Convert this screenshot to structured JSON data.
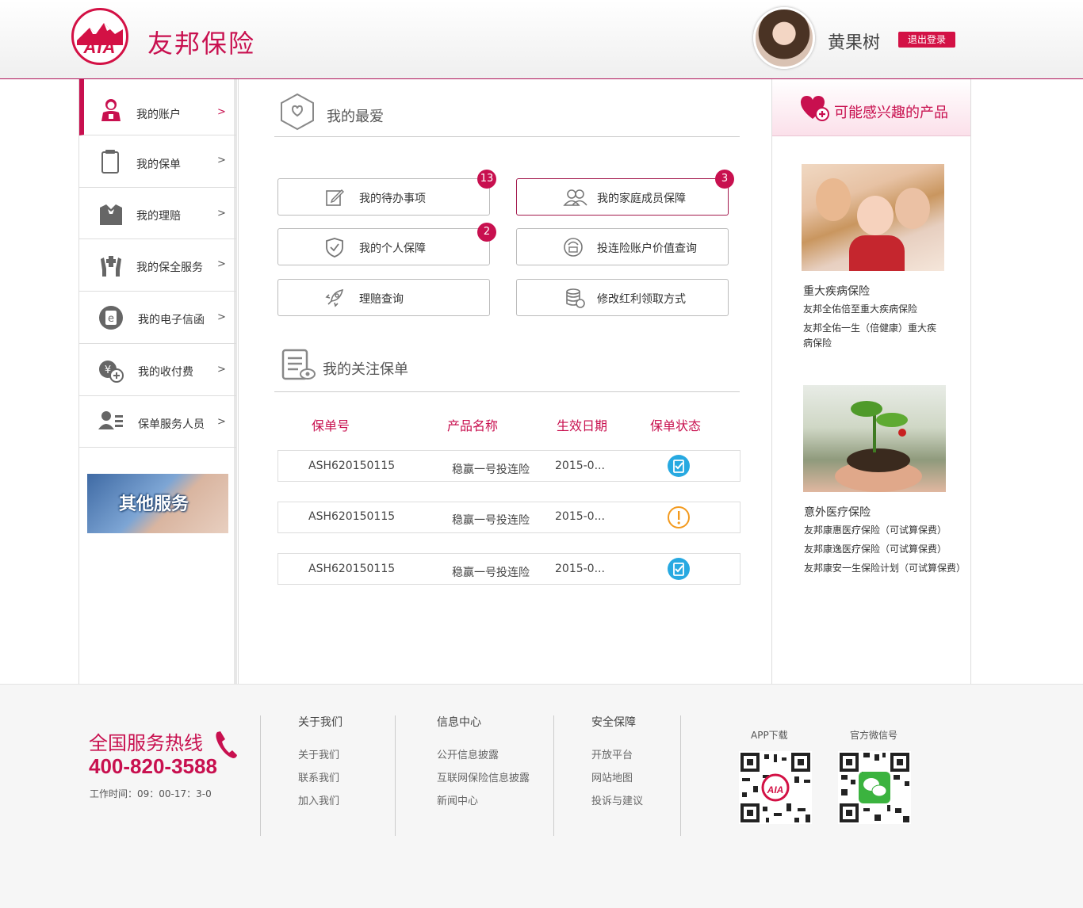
{
  "header": {
    "logo_text": "AIA",
    "brand": "友邦保险",
    "user_name": "黄果树",
    "logout_label": "退出登录"
  },
  "sidebar": {
    "items": [
      {
        "label": "我的账户",
        "arrow": ">"
      },
      {
        "label": "我的保单",
        "arrow": ">"
      },
      {
        "label": "我的理赔",
        "arrow": ">"
      },
      {
        "label": "我的保全服务",
        "arrow": ">"
      },
      {
        "label": "我的电子信函",
        "arrow": ">"
      },
      {
        "label": "我的收付费",
        "arrow": ">"
      },
      {
        "label": "保单服务人员",
        "arrow": ">"
      }
    ],
    "banner_label": "其他服务"
  },
  "favorites": {
    "title": "我的最爱",
    "buttons": [
      {
        "label": "我的待办事项",
        "badge": "13"
      },
      {
        "label": "我的家庭成员保障",
        "badge": "3"
      },
      {
        "label": "我的个人保障",
        "badge": "2"
      },
      {
        "label": "投连险账户价值查询"
      },
      {
        "label": "理赔查询"
      },
      {
        "label": "修改红利领取方式"
      }
    ]
  },
  "watched": {
    "title": "我的关注保单",
    "columns": [
      "保单号",
      "产品名称",
      "生效日期",
      "保单状态"
    ],
    "rows": [
      {
        "policy_no": "ASH620150115",
        "product": "稳赢一号投连险",
        "date": "2015-0...",
        "status": "valid"
      },
      {
        "policy_no": "ASH620150115",
        "product": "稳赢一号投连险",
        "date": "2015-0...",
        "status": "warning"
      },
      {
        "policy_no": "ASH620150115",
        "product": "稳赢一号投连险",
        "date": "2015-0...",
        "status": "valid"
      }
    ]
  },
  "recommend": {
    "title": "可能感兴趣的产品",
    "groups": [
      {
        "category": "重大疾病保险",
        "links": [
          "友邦全佑倍至重大疾病保险",
          "友邦全佑一生（倍健康）重大疾",
          "病保险"
        ]
      },
      {
        "category": "意外医疗保险",
        "links": [
          "友邦康惠医疗保险（可试算保费）",
          "友邦康逸医疗保险（可试算保费）",
          "友邦康安一生保险计划（可试算保费）"
        ]
      }
    ]
  },
  "footer": {
    "hotline_title": "全国服务热线",
    "hotline_number": "400-820-3588",
    "hours": "工作时间：09：00-17：3-0",
    "columns": [
      {
        "title": "关于我们",
        "links": [
          "关于我们",
          "联系我们",
          "加入我们"
        ]
      },
      {
        "title": "信息中心",
        "links": [
          "公开信息披露",
          "互联网保险信息披露",
          "新闻中心"
        ]
      },
      {
        "title": "安全保障",
        "links": [
          "开放平台",
          "网站地图",
          "投诉与建议"
        ]
      }
    ],
    "qr": [
      {
        "label": "APP下载"
      },
      {
        "label": "官方微信号"
      }
    ]
  },
  "colors": {
    "brand": "#c8104f",
    "status_valid": "#27a9e1",
    "status_warning": "#f39a1e"
  }
}
